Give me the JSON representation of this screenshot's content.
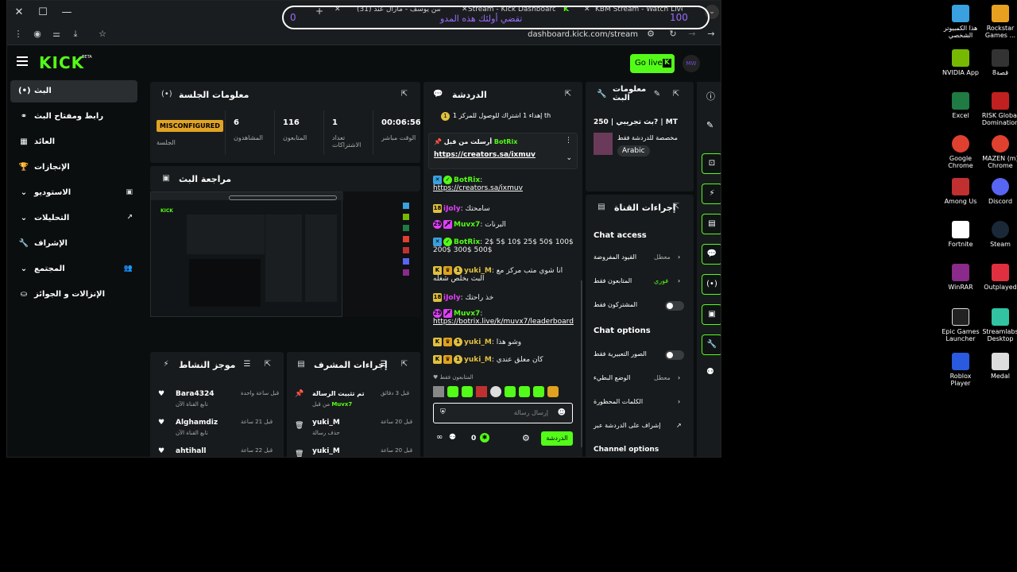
{
  "browser": {
    "tabs": [
      {
        "label": "KBM Stream - Watch Live on"
      },
      {
        "label": "Stream - Kick Dashboard"
      },
      {
        "label": "(31) حسن يوسف - مازال عند"
      }
    ],
    "url": "dashboard.kick.com/stream",
    "overlay": {
      "left": "0",
      "right": "100",
      "center": "تقضي أولئك هذه المدو"
    }
  },
  "header": {
    "logo": "KICK",
    "beta": "BETA",
    "go_live": "Go live",
    "avatar": "MW"
  },
  "sidebar": {
    "items": [
      {
        "label": "البث",
        "icon": "(•)"
      },
      {
        "label": "رابط ومفتاح البث",
        "icon": "⚭"
      },
      {
        "label": "العائد",
        "icon": "▦"
      },
      {
        "label": "الإنجازات",
        "icon": "🏆"
      },
      {
        "label": "الاستوديو",
        "icon": "⌄",
        "ricon": "▣"
      },
      {
        "label": "التحليلات",
        "icon": "⌄",
        "ricon": "↗"
      },
      {
        "label": "الإشراف",
        "icon": "🔧"
      },
      {
        "label": "المجتمع",
        "icon": "⌄",
        "ricon": "👥"
      },
      {
        "label": "الإنزالات و الجوائز",
        "icon": "⛀"
      }
    ]
  },
  "session": {
    "title": "معلومات الجلسة",
    "status": "MISCONFIGURED",
    "status_label": "الجلسة",
    "stats": [
      {
        "value": "6",
        "label": "المشاهدون"
      },
      {
        "value": "116",
        "label": "المتابعون"
      },
      {
        "value": "1",
        "label": "تعداد الاشتراكات"
      },
      {
        "value": "00:06:56",
        "label": "الوقت مباشر"
      }
    ]
  },
  "preview": {
    "title": "مراجعة البث"
  },
  "activity": {
    "title": "موجز النشاط",
    "rows": [
      {
        "name": "Bara4324",
        "sub": "تابع القناة الآن",
        "time": "قبل ساعة واحدة"
      },
      {
        "name": "Alghamdiz",
        "sub": "تابع القناة الآن",
        "time": "قبل 21 ساعة"
      },
      {
        "name": "ahtihall",
        "sub": "",
        "time": "قبل 22 ساعة"
      }
    ]
  },
  "modactions": {
    "title": "إجراءات المشرف",
    "rows": [
      {
        "name": "تم تثبيت الرسالة",
        "sub": "Muvx7",
        "sub_prefix": "من قبل",
        "time": "قبل 3 دقائق"
      },
      {
        "name": "yuki_M",
        "sub": "حذف رسالة",
        "time": "قبل 20 ساعة"
      },
      {
        "name": "yuki_M",
        "sub": "",
        "time": "قبل 20 ساعة"
      }
    ]
  },
  "chat": {
    "title": "الدردشة",
    "goal": "إهداء 1 اشتراك للوصول للمركز 1",
    "goal_suffix": "th",
    "pinned_by": "أرسلت من قبل",
    "pinned_user": "BotRix",
    "pinned_link": "https://creators.sa/ixmuv",
    "messages": [
      {
        "user": "BotRix",
        "text": "https://creators.sa/ixmuv",
        "link": true,
        "color": "#53fc18"
      },
      {
        "user": "iJoly",
        "text": "سامحتك",
        "color": "#e040fb",
        "badge": "18"
      },
      {
        "user": "Muvx7",
        "text": "البرنات",
        "color": "#53fc18",
        "badge": "29"
      },
      {
        "user": "BotRix",
        "text": "2$ 5$ 10$ 25$ 50$ 100$ 200$ 300$ 500$",
        "color": "#53fc18"
      },
      {
        "user": "yuki_M",
        "text": "انا شوي متب مركز مع البث بخلص شغله",
        "color": "#e0c040"
      },
      {
        "user": "iJoly",
        "text": "خذ راحتك",
        "color": "#e040fb",
        "badge": "18"
      },
      {
        "user": "Muvx7",
        "text": "https://botrix.live/k/muvx7/leaderboard",
        "link": true,
        "color": "#53fc18",
        "badge": "29"
      },
      {
        "user": "yuki_M",
        "text": "وشو هذا",
        "color": "#e0c040"
      },
      {
        "user": "yuki_M",
        "text": "كان معلق عندي",
        "color": "#e0c040"
      }
    ],
    "followers_only": "المتابعون فقط",
    "input_placeholder": "إرسال رسالة",
    "send": "الدردشة",
    "count": "0",
    "infinity": "∞"
  },
  "streaminfo": {
    "title": "معلومات البث",
    "stream_title": "بث تجريبي | 250? | MT",
    "category": "مخصصة للدردشة فقط",
    "tag": "Arabic"
  },
  "channelactions": {
    "title": "إجراءات القناة",
    "access_title": "Chat access",
    "access_rows": [
      {
        "label": "القيود المفروضة",
        "value": "معطل"
      },
      {
        "label": "المتابعون فقط",
        "value": "فوري"
      },
      {
        "label": "المشتركون فقط",
        "value": ""
      }
    ],
    "options_title": "Chat options",
    "options_rows": [
      {
        "label": "الصور التعبيرية فقط",
        "value": ""
      },
      {
        "label": "الوضع البطيء",
        "value": "معطل"
      },
      {
        "label": "الكلمات المحظورة",
        "value": ""
      },
      {
        "label": "إشراف على الدردشة عبر",
        "value": ""
      }
    ],
    "channel_options": "Channel options"
  },
  "desktop": {
    "icons": [
      {
        "label": "هذا الكمبيوتر الشخصي",
        "color": "#3aa0e0"
      },
      {
        "label": "Rockstar Games ...",
        "color": "#e8a020"
      },
      {
        "label": "NVIDIA App",
        "color": "#76b900"
      },
      {
        "label": "8قصة",
        "color": "#333333"
      },
      {
        "label": "Excel",
        "color": "#1f7a43"
      },
      {
        "label": "RISK Global Domination",
        "color": "#c02020"
      },
      {
        "label": "Google Chrome",
        "color": "#e04030"
      },
      {
        "label": "MAZEN (m) Chrome",
        "color": "#e04030"
      },
      {
        "label": "Among Us",
        "color": "#c03030"
      },
      {
        "label": "Discord",
        "color": "#5865f2"
      },
      {
        "label": "Fortnite",
        "color": "#ffffff"
      },
      {
        "label": "Steam",
        "color": "#1b2838"
      },
      {
        "label": "WinRAR",
        "color": "#8a2a8a"
      },
      {
        "label": "Outplayed",
        "color": "#e03040"
      },
      {
        "label": "Epic Games Launcher",
        "color": "#222222"
      },
      {
        "label": "Streamlabs Desktop",
        "color": "#31c3a2"
      },
      {
        "label": "Roblox Player",
        "color": "#2a5adf"
      },
      {
        "label": "Medal",
        "color": "#dddddd"
      }
    ]
  },
  "colors": {
    "accent": "#53fc18",
    "panel": "#181b1d",
    "bg": "#0b0e0f"
  }
}
